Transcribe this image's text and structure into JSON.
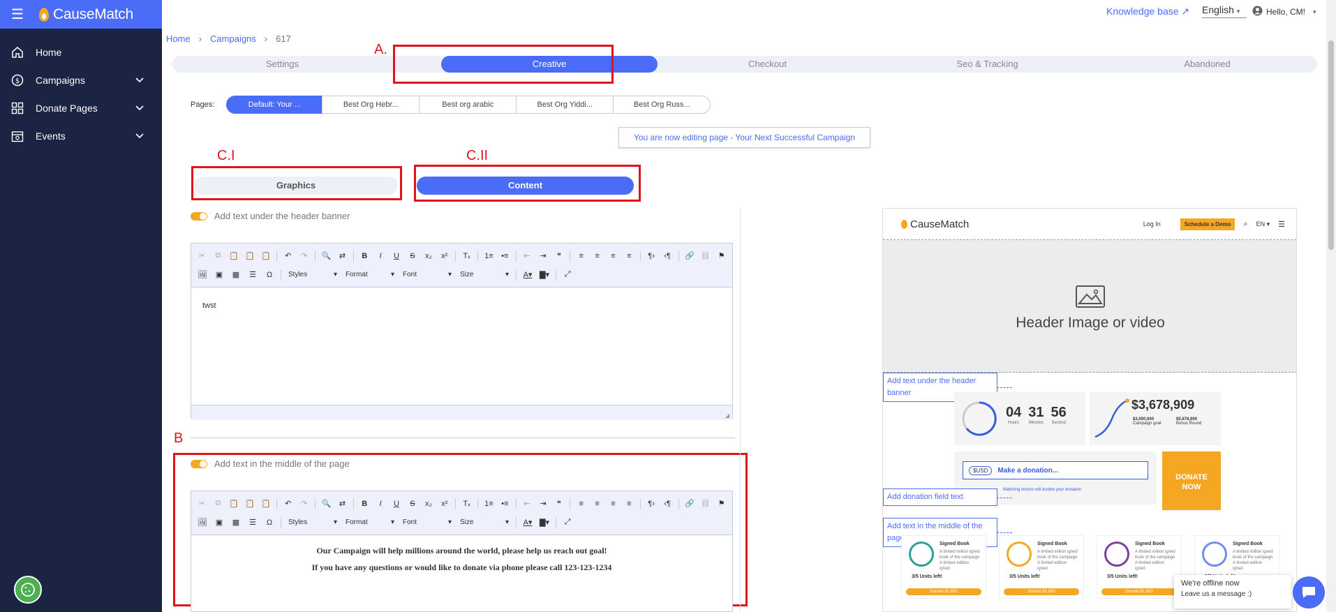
{
  "app": {
    "brand": "CauseMatch"
  },
  "sidebar": {
    "items": [
      {
        "label": "Home",
        "icon": "home-icon",
        "expandable": false
      },
      {
        "label": "Campaigns",
        "icon": "dollar-icon",
        "expandable": true
      },
      {
        "label": "Donate Pages",
        "icon": "grid-icon",
        "expandable": true
      },
      {
        "label": "Events",
        "icon": "calendar-icon",
        "expandable": true
      }
    ]
  },
  "topbar": {
    "knowledge_base": "Knowledge base ↗",
    "language": "English",
    "greeting": "Hello, CM!"
  },
  "breadcrumb": {
    "home": "Home",
    "campaigns": "Campaigns",
    "current": "617"
  },
  "tabs": [
    "Settings",
    "Creative",
    "Checkout",
    "Seo & Tracking",
    "Abandoned"
  ],
  "active_tab": "Creative",
  "pages": {
    "label": "Pages:",
    "items": [
      "Default: Your ...",
      "Best Org Hebr...",
      "Best org arabic",
      "Best Org Yiddi...",
      "Best Org Russ..."
    ]
  },
  "editing_notice": "You are now editing page - Your Next Successful Campaign",
  "subtabs": {
    "graphics": "Graphics",
    "content": "Content"
  },
  "annotations": {
    "a": "A.",
    "b": "B",
    "c1": "C.I",
    "c2": "C.II"
  },
  "sections": {
    "header_text": {
      "toggle_label": "Add text under the header banner",
      "body": "twst"
    },
    "middle_text": {
      "toggle_label": "Add text in the middle of the page",
      "line1": "Our Campaign will help millions around the world, please help us reach out goal!",
      "line2": "If you have any questions or would like to donate via phone please call 123-123-1234"
    }
  },
  "toolbar": {
    "styles": "Styles",
    "format": "Format",
    "font": "Font",
    "size": "Size"
  },
  "preview": {
    "brand": "CauseMatch",
    "login": "Log In",
    "demo": "Schedule a Demo",
    "lang": "EN",
    "hero_text": "Header Image or video",
    "label_header": "Add text under the header banner",
    "label_donation": "Add donation field text",
    "label_middle": "Add text in the middle of the page",
    "timer": {
      "hours": "04",
      "minutes": "31",
      "seconds": "56",
      "h_lbl": "Hours",
      "m_lbl": "Minutes",
      "s_lbl": "Second"
    },
    "raised": "$3,678,909",
    "goal": "$3,000,000",
    "goal_lbl": "Campaign goal",
    "bonus": "$5,678,900",
    "bonus_lbl": "Bonus Round",
    "currency": "$USD",
    "make_donation": "Make a donation...",
    "matching": "Matching donors will double your donation",
    "donate_now": "DONATE NOW",
    "product": {
      "title": "Signed Book",
      "desc": "A limited million igned book of the campaign A limited edition igned",
      "units": "3/5 Units left!",
      "button": "Donate $1,800"
    }
  },
  "chat": {
    "line1": "We're offline now",
    "line2": "Leave us a message :)"
  },
  "colors": {
    "primary": "#4a6cf7",
    "sidebar": "#1b2442",
    "accent": "#f5a623",
    "annotation": "#e0151b"
  }
}
